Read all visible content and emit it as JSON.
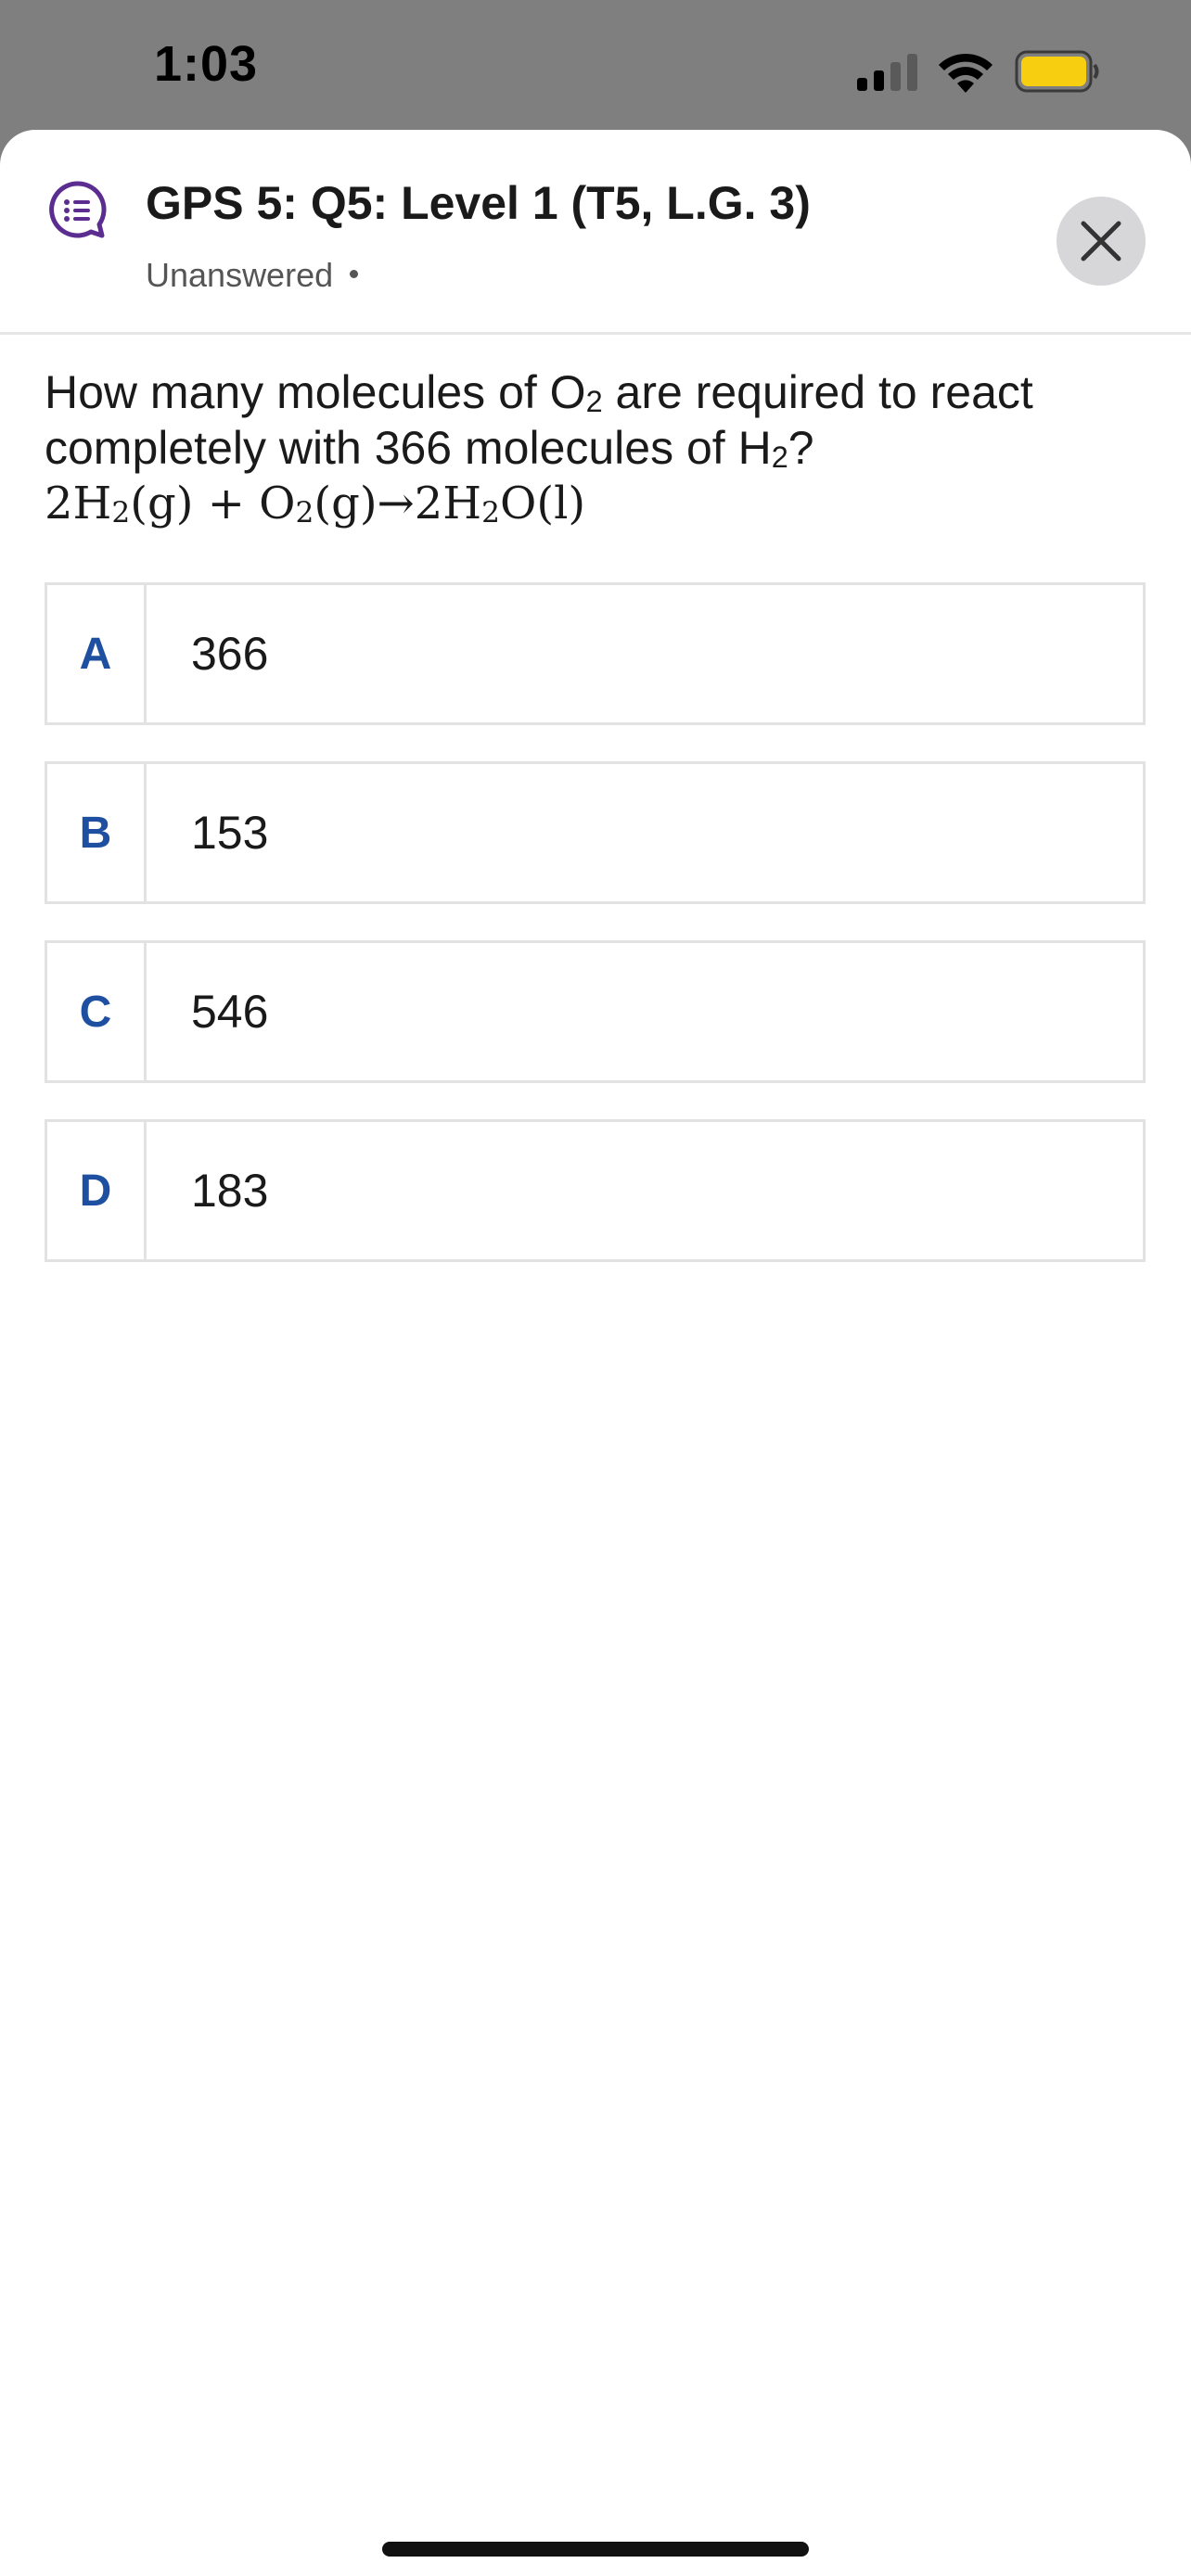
{
  "status_bar": {
    "time": "1:03",
    "battery_color": "#f8cf10"
  },
  "header": {
    "title": "GPS 5: Q5: Level 1 (T5, L.G. 3)",
    "status": "Unanswered",
    "icon": "chat-list-icon",
    "icon_color": "#5b2d91"
  },
  "question": {
    "text_part1": "How many molecules of ",
    "o": "O",
    "sub2": "2",
    "text_part2": " are required to react completely with 366 molecules of ",
    "h": "H",
    "text_part3": "?",
    "equation": {
      "t1": "2H",
      "t2": "(g) + O",
      "t3": "(g)→2H",
      "t4": "O(l)"
    }
  },
  "options": [
    {
      "letter": "A",
      "value": "366"
    },
    {
      "letter": "B",
      "value": "153"
    },
    {
      "letter": "C",
      "value": "546"
    },
    {
      "letter": "D",
      "value": "183"
    }
  ],
  "colors": {
    "accent": "#1f4fa0",
    "backdrop": "#7f7f7f"
  }
}
